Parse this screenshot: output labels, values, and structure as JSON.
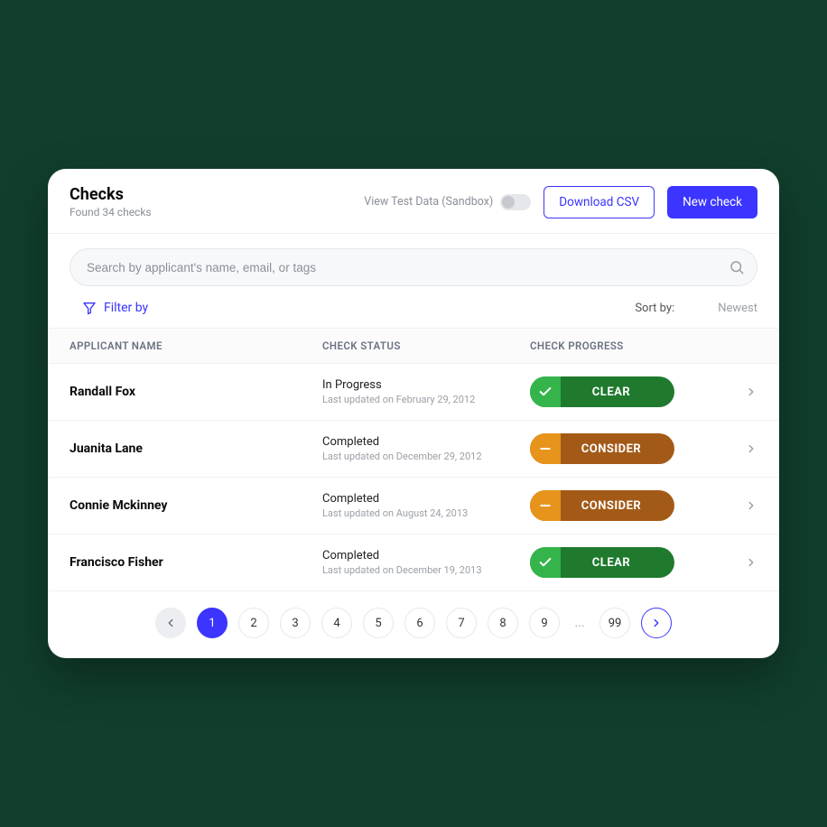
{
  "header": {
    "title": "Checks",
    "subtitle": "Found 34 checks",
    "sandbox_label": "View Test Data (Sandbox)",
    "download_label": "Download CSV",
    "newcheck_label": "New check"
  },
  "search": {
    "placeholder": "Search by applicant's name, email, or tags"
  },
  "filter": {
    "filter_label": "Filter by",
    "sort_label": "Sort by:",
    "sort_value": "Newest"
  },
  "columns": {
    "c1": "APPLICANT NAME",
    "c2": "CHECK STATUS",
    "c3": "CHECK PROGRESS"
  },
  "rows": [
    {
      "name": "Randall Fox",
      "status": "In Progress",
      "updated": "Last updated on February 29, 2012",
      "progress_type": "clear",
      "progress_label": "CLEAR"
    },
    {
      "name": "Juanita Lane",
      "status": "Completed",
      "updated": "Last updated on December 29, 2012",
      "progress_type": "consider",
      "progress_label": "CONSIDER"
    },
    {
      "name": "Connie Mckinney",
      "status": "Completed",
      "updated": "Last updated on August 24, 2013",
      "progress_type": "consider",
      "progress_label": "CONSIDER"
    },
    {
      "name": "Francisco Fisher",
      "status": "Completed",
      "updated": "Last updated on December 19, 2013",
      "progress_type": "clear",
      "progress_label": "CLEAR"
    }
  ],
  "pagination": {
    "pages": [
      "1",
      "2",
      "3",
      "4",
      "5",
      "6",
      "7",
      "8",
      "9"
    ],
    "last": "99",
    "active": "1",
    "ellipsis": "..."
  }
}
